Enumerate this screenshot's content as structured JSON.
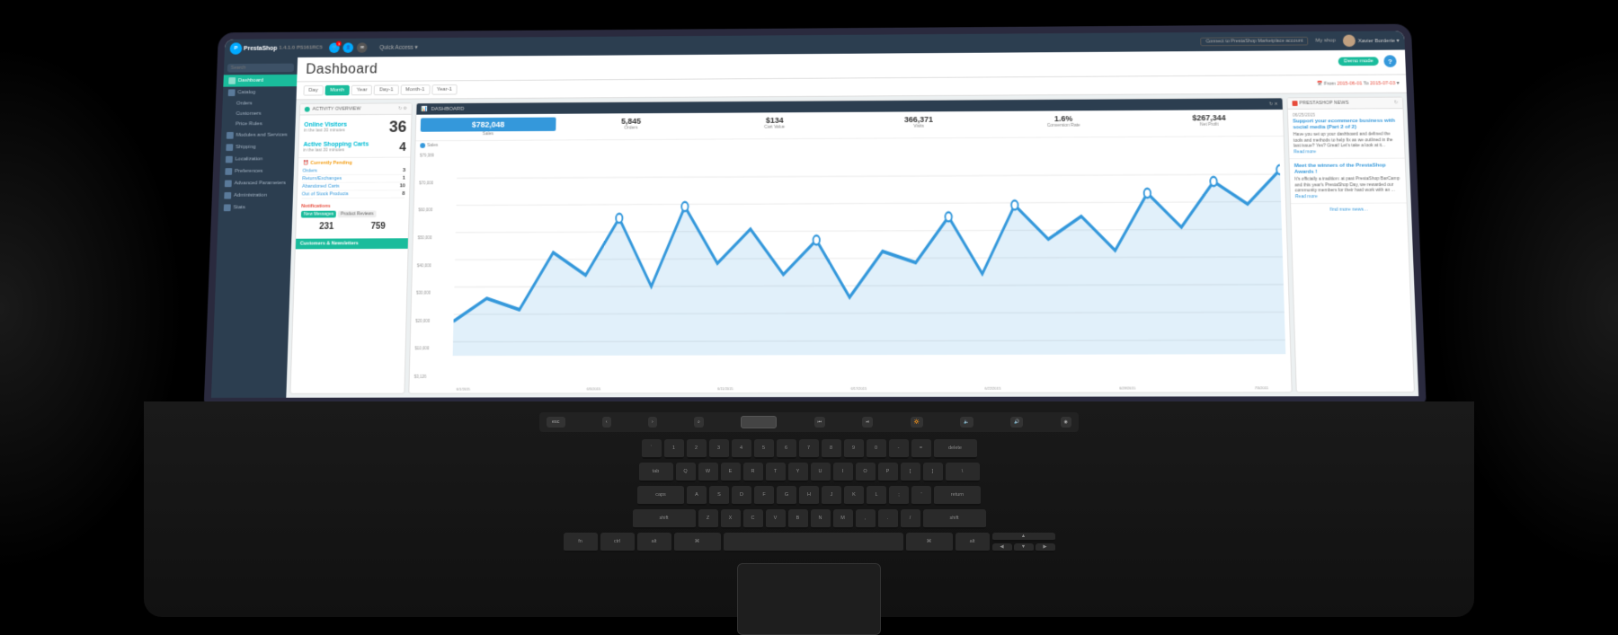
{
  "app": {
    "name": "PrestaShop",
    "version": "1.4.1.0",
    "build": "PS161RC5"
  },
  "navbar": {
    "logo_label": "PrestaShop",
    "version": "1.4.1.0",
    "build": "PS161RC5",
    "quick_access": "Quick Access ▾",
    "connect_btn": "Connect to PrestaShop Marketplace account",
    "my_shop": "My shop",
    "user_name": "Xavier Borderie ▾"
  },
  "sidebar": {
    "search_placeholder": "Search",
    "items": [
      {
        "label": "Dashboard",
        "active": true
      },
      {
        "label": "Catalog",
        "active": false
      },
      {
        "label": "Orders",
        "active": false
      },
      {
        "label": "Customers",
        "active": false
      },
      {
        "label": "Price Rules",
        "active": false
      },
      {
        "label": "Modules and Services",
        "active": false
      },
      {
        "label": "Shipping",
        "active": false
      },
      {
        "label": "Localization",
        "active": false
      },
      {
        "label": "Preferences",
        "active": false
      },
      {
        "label": "Advanced Parameters",
        "active": false
      },
      {
        "label": "Administration",
        "active": false
      },
      {
        "label": "Stats",
        "active": false
      }
    ]
  },
  "page": {
    "title": "Dashboard",
    "demo_mode": "Demo mode",
    "help": "Help"
  },
  "date_tabs": {
    "tabs": [
      "Day",
      "Month",
      "Year",
      "Day-1",
      "Month-1",
      "Year-1"
    ],
    "active": "Month",
    "date_range": "From 2015-06-01 To 2015-07-03"
  },
  "activity_overview": {
    "title": "ACTIVITY OVERVIEW",
    "online_visitors_label": "Online Visitors",
    "online_visitors_sub": "in the last 30 minutes",
    "online_visitors_count": "36",
    "shopping_carts_label": "Active Shopping Carts",
    "shopping_carts_sub": "in the last 30 minutes",
    "shopping_carts_count": "4",
    "pending_title": "Currently Pending",
    "pending_items": [
      {
        "label": "Orders",
        "count": "3"
      },
      {
        "label": "Return/Exchanges",
        "count": "1"
      },
      {
        "label": "Abandoned Carts",
        "count": "10"
      },
      {
        "label": "Out of Stock Products",
        "count": "8"
      }
    ],
    "notifications_title": "Notifications",
    "notifications_tabs": [
      "New Messages",
      "Product Reviews"
    ],
    "notifications_numbers": [
      "231",
      "759"
    ],
    "customers_label": "Customers & Newsletters"
  },
  "dashboard_chart": {
    "title": "DASHBOARD",
    "tabs": [
      "Sales",
      "Orders",
      "Cart Value",
      "Visits",
      "Conversion Rate",
      "Net Profit"
    ],
    "active_tab": "Sales",
    "stats": [
      {
        "label": "Sales",
        "value": "$782,048",
        "highlighted": true
      },
      {
        "label": "Orders",
        "value": "5,845"
      },
      {
        "label": "Cart Value",
        "value": "$134"
      },
      {
        "label": "Visits",
        "value": "366,371"
      },
      {
        "label": "Conversion Rate",
        "value": "1.6%"
      },
      {
        "label": "Net Profit",
        "value": "$267,344"
      }
    ],
    "y_labels": [
      "$79,389",
      "$70,000",
      "$60,000",
      "$50,000",
      "$40,000",
      "$30,000",
      "$20,000",
      "$10,000",
      "$3,126"
    ],
    "x_labels": [
      "6/1/2015",
      "6/5/2015",
      "6/11/2015",
      "6/17/2015",
      "6/22/2015",
      "6/28/2015",
      "7/3/2011"
    ],
    "legend": [
      {
        "label": "Sales",
        "color": "#3498db"
      }
    ]
  },
  "news": {
    "title": "PRESTASHOP NEWS",
    "items": [
      {
        "date": "06/25/2015",
        "title": "Support your ecommerce business with social media (Part 2 of 2)",
        "body": "Have you set up your dashboard and defined the tools and methods to help fix as we outlined in the last issue? Yes? Great! Let's take a look at it...",
        "readmore": "Read more"
      },
      {
        "date": "",
        "title": "Meet the winners of the PrestaShop Awards !",
        "body": "It's officially a tradition: at past PrestaShop BarCamp and this year's PrestaShop Day, we rewarded our community members for their hard work with an ...",
        "readmore": "Read more"
      }
    ],
    "more_link": "find more news..."
  },
  "keyboard": {
    "touchbar_keys": [
      "esc",
      "<",
      ">",
      "🔍",
      "⏮",
      "⏯",
      "🔆",
      "🔈",
      "🔊",
      "◉"
    ],
    "rows": [
      [
        "~",
        "!",
        "@",
        "#",
        "$",
        "%",
        "^",
        "&",
        "*",
        "(",
        ")",
        "—",
        "+",
        "delete"
      ],
      [
        "`",
        "1",
        "2",
        "3",
        "4",
        "5",
        "6",
        "7",
        "8",
        "9",
        "0",
        "-",
        "=",
        "delete"
      ],
      [
        "tab",
        "Q",
        "W",
        "E",
        "R",
        "T",
        "Y",
        "U",
        "I",
        "O",
        "P",
        "{",
        "}",
        "\\"
      ],
      [
        "caps",
        "A",
        "S",
        "D",
        "F",
        "G",
        "H",
        "J",
        "K",
        "L",
        ":",
        "\\'",
        "return"
      ],
      [
        "shift",
        "Z",
        "X",
        "C",
        "V",
        "B",
        "N",
        "M",
        "<",
        ">",
        "?",
        "shift"
      ],
      [
        "fn",
        "ctrl",
        "alt",
        "cmd",
        "space",
        "cmd",
        "alt"
      ]
    ]
  }
}
